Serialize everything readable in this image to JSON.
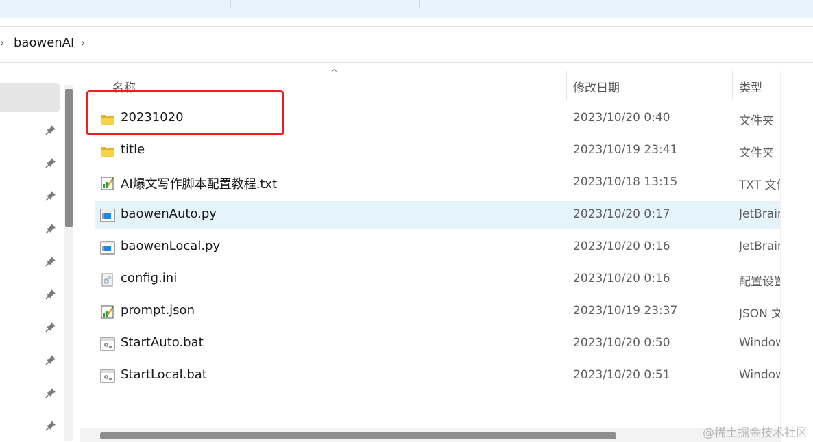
{
  "breadcrumb": {
    "folder": "baowenAI"
  },
  "columns": {
    "name": "名称",
    "date": "修改日期",
    "type": "类型"
  },
  "files": [
    {
      "name": "20231020",
      "date": "2023/10/20 0:40",
      "type": "文件夹",
      "icon": "folder-icon"
    },
    {
      "name": "title",
      "date": "2023/10/19 23:41",
      "type": "文件夹",
      "icon": "folder-icon"
    },
    {
      "name": "AI爆文写作脚本配置教程.txt",
      "date": "2023/10/18 13:15",
      "type": "TXT 文件",
      "icon": "text-file-icon"
    },
    {
      "name": "baowenAuto.py",
      "date": "2023/10/20 0:17",
      "type": "JetBrains",
      "icon": "python-file-icon"
    },
    {
      "name": "baowenLocal.py",
      "date": "2023/10/20 0:16",
      "type": "JetBrains",
      "icon": "python-file-icon"
    },
    {
      "name": "config.ini",
      "date": "2023/10/20 0:16",
      "type": "配置设置",
      "icon": "config-file-icon"
    },
    {
      "name": "prompt.json",
      "date": "2023/10/19 23:37",
      "type": "JSON 文件",
      "icon": "text-file-icon"
    },
    {
      "name": "StartAuto.bat",
      "date": "2023/10/20 0:50",
      "type": "Windows",
      "icon": "batch-file-icon"
    },
    {
      "name": "StartLocal.bat",
      "date": "2023/10/20 0:51",
      "type": "Windows",
      "icon": "batch-file-icon"
    }
  ],
  "watermark": "@稀土掘金技术社区",
  "colors": {
    "highlight": "#e5f3fb",
    "annotation": "#f01d1d",
    "folder": "#f5c83a"
  }
}
